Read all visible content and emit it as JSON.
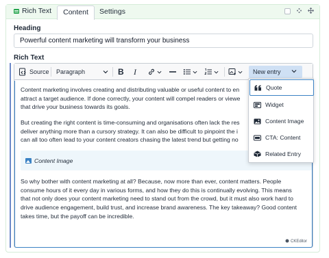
{
  "block": {
    "type_label": "Rich Text",
    "tabs": [
      {
        "label": "Content",
        "active": true
      },
      {
        "label": "Settings",
        "active": false
      }
    ]
  },
  "fields": {
    "heading": {
      "label": "Heading",
      "value": "Powerful content marketing will transform your business"
    },
    "rich_text": {
      "label": "Rich Text"
    }
  },
  "toolbar": {
    "source_label": "Source",
    "heading_style": "Paragraph",
    "new_entry_label": "New entry",
    "icons": [
      "source-icon",
      "bold-icon",
      "italic-icon",
      "link-icon",
      "horizontal-line-icon",
      "bulleted-list-icon",
      "numbered-list-icon",
      "media-icon",
      "chevron-down-icon"
    ]
  },
  "content": {
    "paragraph1_lines": [
      "Content marketing involves creating and distributing valuable or useful content to en",
      "attract a target audience. If done correctly, your content will compel readers or viewe",
      "that drive your business towards its goals."
    ],
    "paragraph2_lines": [
      "But creating the right content is time-consuming and organisations often lack the res",
      "deliver anything more than a cursory strategy. It can also be difficult to pinpoint the i",
      "can all too often lead to your content creators chasing the latest trend but getting no"
    ],
    "embed_label": "Content Image",
    "paragraph3_lines": [
      "So why bother with content marketing at all? Because, now more than ever, content matters. People",
      "consume hours of it every day in various forms, and how they do this is continually evolving. This means",
      "that not only does your content marketing need to stand out from the crowd, but it must also work hard to",
      "drive audience engagement, build trust, and increase brand awareness. The key takeaway? Good content",
      "takes time, but the payoff can be incredible."
    ],
    "credits": "CKEditor"
  },
  "new_entry_menu": {
    "items": [
      {
        "label": "Quote",
        "icon": "quote-icon",
        "active": true
      },
      {
        "label": "Widget",
        "icon": "widget-icon",
        "active": false
      },
      {
        "label": "Content Image",
        "icon": "image-icon",
        "active": false
      },
      {
        "label": "CTA: Content",
        "icon": "cta-icon",
        "active": false
      },
      {
        "label": "Related Entry",
        "icon": "related-entry-icon",
        "active": false
      }
    ]
  },
  "colors": {
    "accent": "#3b82c4",
    "tab_bar_bg": "#eef9ef",
    "new_entry_bg": "#cfe0f4",
    "embed_bg": "#eef6fb",
    "editor_accent": "#6b87c7"
  }
}
